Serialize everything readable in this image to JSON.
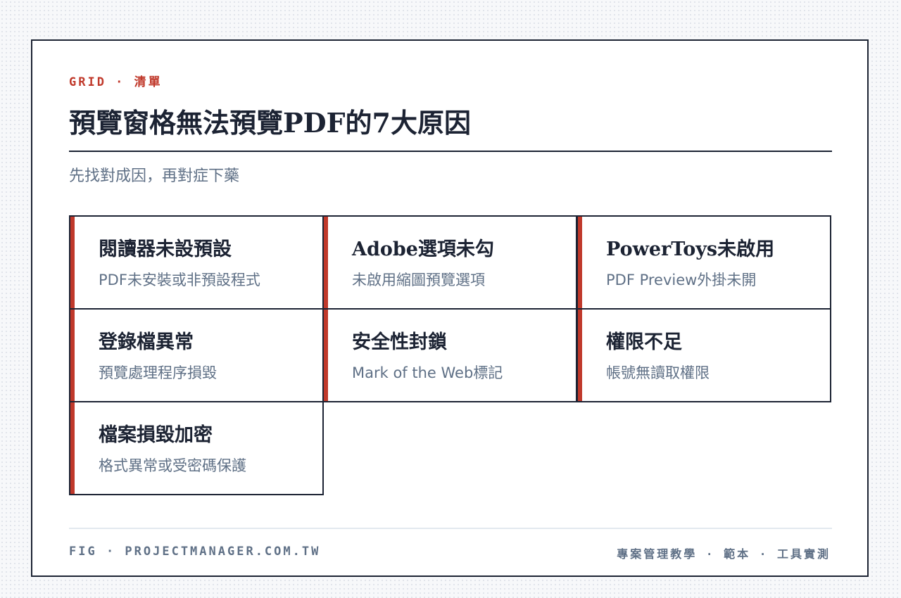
{
  "header": {
    "eyebrow": "GRID · 清單",
    "title": "預覽窗格無法預覽PDF的7大原因",
    "subtitle": "先找對成因，再對症下藥"
  },
  "items": [
    {
      "title": "閱讀器未設預設",
      "desc": "PDF未安裝或非預設程式"
    },
    {
      "title": "Adobe選項未勾",
      "desc": "未啟用縮圖預覽選項"
    },
    {
      "title": "PowerToys未啟用",
      "desc": "PDF Preview外掛未開"
    },
    {
      "title": "登錄檔異常",
      "desc": "預覽處理程序損毀"
    },
    {
      "title": "安全性封鎖",
      "desc": "Mark of the Web標記"
    },
    {
      "title": "權限不足",
      "desc": "帳號無讀取權限"
    },
    {
      "title": "檔案損毀加密",
      "desc": "格式異常或受密碼保護"
    }
  ],
  "footer": {
    "left": "FIG · PROJECTMANAGER.COM.TW",
    "right": "專案管理教學 · 範本 · 工具實測"
  },
  "colors": {
    "accent": "#c0392b",
    "ink": "#1c2333",
    "muted": "#5f7086"
  }
}
